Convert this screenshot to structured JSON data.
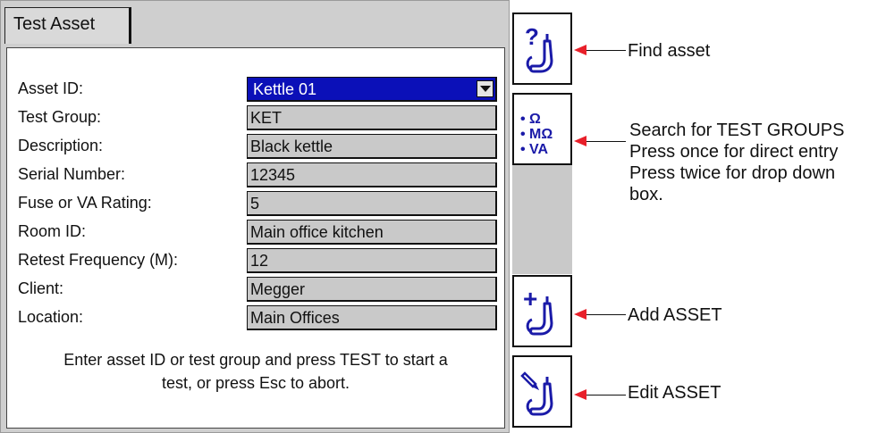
{
  "tab": {
    "label": "Test Asset"
  },
  "form": {
    "rows": [
      {
        "label": "Asset ID:",
        "value": "Kettle 01"
      },
      {
        "label": "Test Group:",
        "value": "KET"
      },
      {
        "label": "Description:",
        "value": "Black kettle"
      },
      {
        "label": "Serial Number:",
        "value": "12345"
      },
      {
        "label": "Fuse or VA Rating:",
        "value": "5"
      },
      {
        "label": "Room ID:",
        "value": "Main office kitchen"
      },
      {
        "label": "Retest Frequency (M):",
        "value": "12"
      },
      {
        "label": "Client:",
        "value": "Megger"
      },
      {
        "label": "Location:",
        "value": "Main Offices"
      }
    ],
    "help_line1": "Enter asset ID or test group and press TEST to start a",
    "help_line2": "test, or press Esc to abort."
  },
  "softkeys": {
    "find": {
      "icon": "find-asset-icon",
      "glyph": "?"
    },
    "test_groups": {
      "icon": "test-groups-icon",
      "lines": [
        "• Ω",
        "• MΩ",
        "• VA"
      ]
    },
    "add": {
      "icon": "add-asset-icon",
      "glyph": "+"
    },
    "edit": {
      "icon": "edit-asset-icon"
    }
  },
  "annotations": {
    "find": "Find asset",
    "test_groups_1": "Search for TEST GROUPS",
    "test_groups_2": "Press once for direct entry",
    "test_groups_3": "Press twice for drop down",
    "test_groups_4": "box.",
    "add": "Add ASSET",
    "edit": "Edit ASSET"
  },
  "colors": {
    "selection": "#0b10b8",
    "field_bg": "#c9c9c9",
    "icon_blue": "#1a1aa8",
    "arrow_red": "#e8202a"
  }
}
